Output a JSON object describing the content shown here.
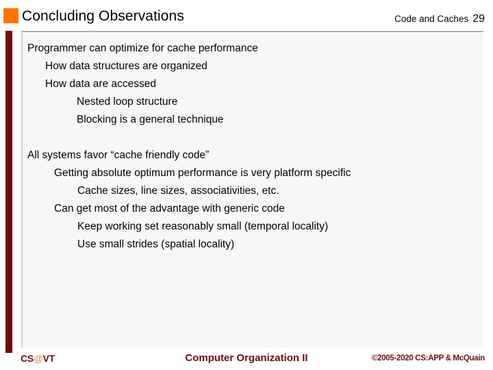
{
  "header": {
    "title": "Concluding Observations",
    "chapter": "Code and Caches",
    "page_number": "29",
    "accent_color": "#ff7300"
  },
  "sidebar": {
    "bar_color": "#6e0d0d"
  },
  "content": {
    "blocks": [
      {
        "lines": [
          {
            "level": 1,
            "text": "Programmer can optimize for cache performance"
          },
          {
            "level": 2,
            "text": "How data structures are organized"
          },
          {
            "level": 2,
            "text": "How data are accessed"
          },
          {
            "level": 3,
            "text": "Nested loop structure"
          },
          {
            "level": 3,
            "text": "Blocking is a general technique"
          }
        ]
      },
      {
        "lines": [
          {
            "level": 1,
            "text": "All systems favor “cache friendly code”"
          },
          {
            "level": 2,
            "text": "Getting absolute optimum performance is very platform specific"
          },
          {
            "level": 3,
            "text": "Cache sizes, line sizes, associativities, etc."
          },
          {
            "level": 2,
            "text": "Can get most of the advantage with generic code"
          },
          {
            "level": 3,
            "text": "Keep working set reasonably small (temporal locality)"
          },
          {
            "level": 3,
            "text": "Use small strides (spatial locality)"
          }
        ]
      }
    ],
    "b1l1": "Programmer can optimize for cache performance",
    "b1l2": "How data structures are organized",
    "b1l3": "How data are accessed",
    "b1l4": "Nested loop structure",
    "b1l5": "Blocking is a general technique",
    "b2l1": "All systems favor “cache friendly code”",
    "b2l2": "Getting absolute optimum performance is very platform specific",
    "b2l3": "Cache sizes, line sizes, associativities, etc.",
    "b2l4": "Can get most of the advantage with generic code",
    "b2l5": "Keep working set reasonably small (temporal locality)",
    "b2l6": "Use small strides (spatial locality)"
  },
  "footer": {
    "logo_prefix": "CS",
    "logo_at": "@",
    "logo_suffix": "VT",
    "center": "Computer Organization II",
    "copyright": "©2005-2020 CS:APP & McQuain",
    "text_color": "#6e0d0d",
    "at_color": "#d79b53"
  }
}
